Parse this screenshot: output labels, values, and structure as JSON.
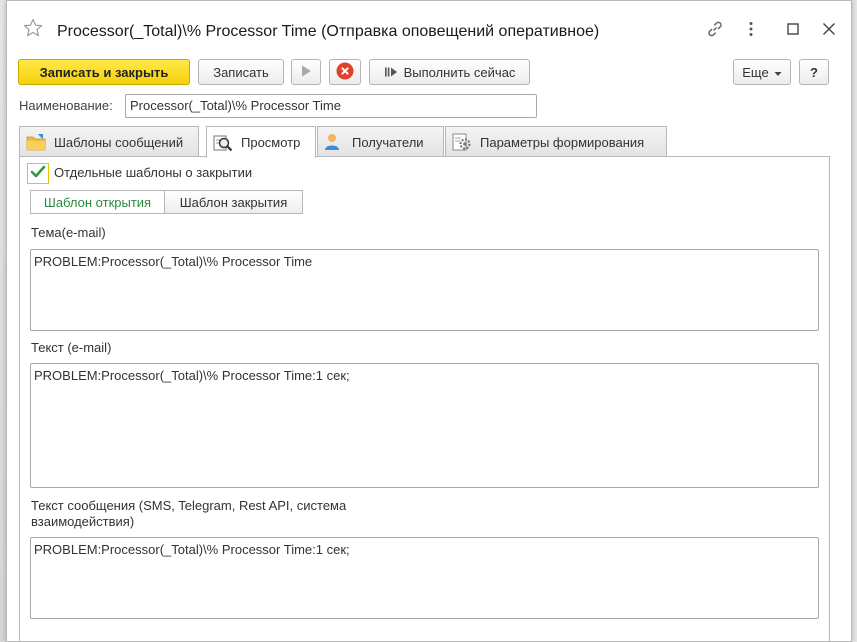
{
  "window": {
    "title": "Processor(_Total)\\% Processor Time (Отправка оповещений оперативное)"
  },
  "toolbar": {
    "save_close": "Записать и закрыть",
    "save": "Записать",
    "execute_now": "Выполнить сейчас",
    "more": "Еще",
    "help": "?"
  },
  "name_field": {
    "label": "Наименование:",
    "value": "Processor(_Total)\\% Processor Time"
  },
  "tabs": [
    {
      "label": "Шаблоны сообщений",
      "icon": "folder-icon"
    },
    {
      "label": "Просмотр",
      "icon": "magnifier-icon"
    },
    {
      "label": "Получатели",
      "icon": "user-icon"
    },
    {
      "label": "Параметры формирования",
      "icon": "settings-icon"
    }
  ],
  "active_tab": 1,
  "checkbox": {
    "label": "Отдельные шаблоны о закрытии",
    "checked": true
  },
  "subtabs": [
    {
      "label": "Шаблон открытия"
    },
    {
      "label": "Шаблон закрытия"
    }
  ],
  "fields": {
    "subject": {
      "label": "Тема(e-mail)",
      "value": "PROBLEM:Processor(_Total)\\% Processor Time"
    },
    "text": {
      "label": "Текст (e-mail)",
      "value": "PROBLEM:Processor(_Total)\\% Processor Time:1 сек;"
    },
    "message": {
      "label": "Текст сообщения (SMS, Telegram, Rest API, система взаимодействия)",
      "value": "PROBLEM:Processor(_Total)\\% Processor Time:1 сек;"
    }
  },
  "colors": {
    "primary_button": "#f5d10a",
    "active_subtab_text": "#2c8a3e",
    "checkbox_border": "#e8c400",
    "stop_icon": "#e2402b"
  }
}
